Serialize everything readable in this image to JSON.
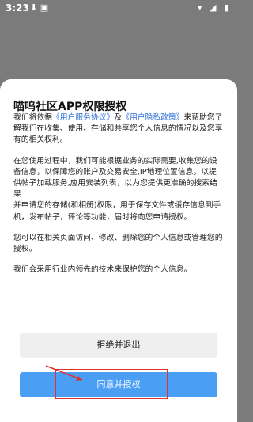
{
  "status_bar": {
    "time": "3:23",
    "left_icons": "⬇ ▣",
    "right_icons": "▾ ◢ ▮"
  },
  "dialog": {
    "title": "喵呜社区APP权限授权",
    "intro_prefix": "我们将依据",
    "link_service": "《用户服务协议》",
    "intro_and": "及",
    "link_privacy": "《用户隐私政策》",
    "intro_suffix": "来帮助您了解我们在收集、使用、存储和共享您个人信息的情况以及您享有的相关权利。",
    "paragraph_2": "在您使用过程中，我们可能根据业务的实际需要,收集您的设备信息，以保障您的账户及交易安全,IP地理位置信息，以提供帖子加载服务,应用安装列表，以为您提供更准确的搜索结果",
    "paragraph_2b": "并申请您的存储(和相册)权限，用于保存文件或缓存信息到手机，发布帖子，评论等功能，届时将向您申请授权。",
    "paragraph_3": "您可以在相关页面访问、修改、删除您的个人信息或管理您的授权。",
    "paragraph_4": "我们会采用行业内领先的技术来保护您的个人信息。"
  },
  "buttons": {
    "decline_label": "拒绝并退出",
    "agree_label": "同意并授权"
  },
  "colors": {
    "link": "#2e6fd8",
    "agree_button": "#4a9ff5",
    "highlight": "#e03030"
  }
}
